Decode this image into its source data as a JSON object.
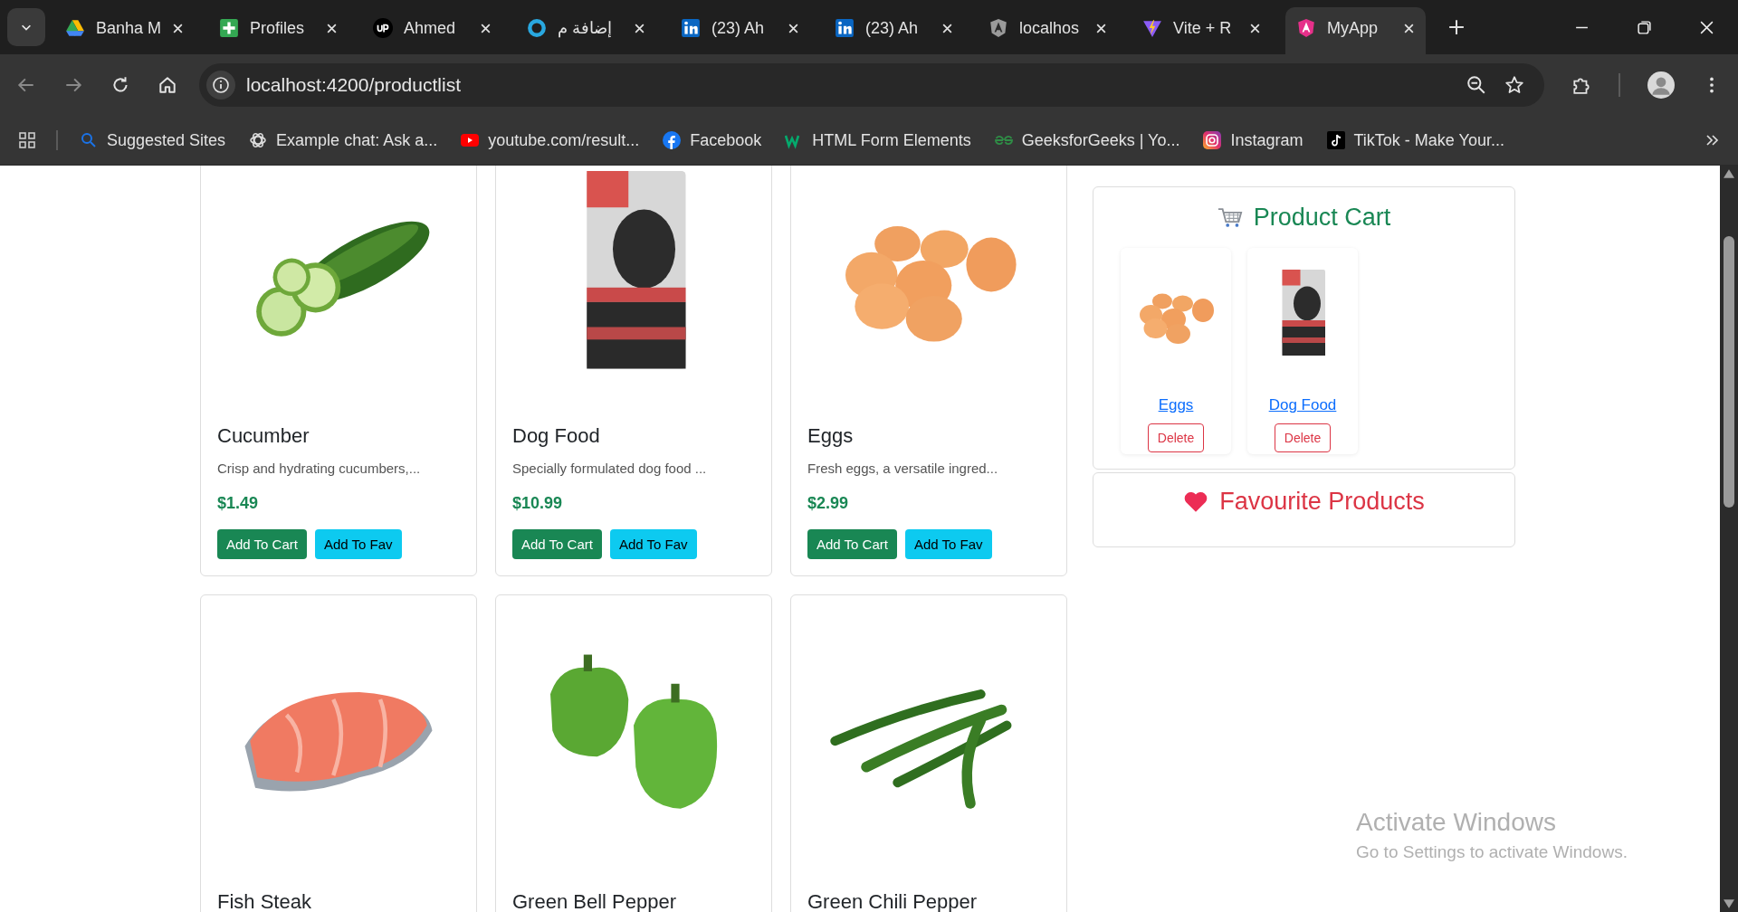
{
  "browser": {
    "tabs": [
      {
        "title": "Banha M",
        "selected": false
      },
      {
        "title": "Profiles",
        "selected": false
      },
      {
        "title": "Ahmed",
        "selected": false
      },
      {
        "title": "إضافة م",
        "selected": false
      },
      {
        "title": "(23) Ah",
        "selected": false
      },
      {
        "title": "(23) Ah",
        "selected": false
      },
      {
        "title": "localhos",
        "selected": false
      },
      {
        "title": "Vite + R",
        "selected": false
      },
      {
        "title": "MyApp",
        "selected": true
      }
    ],
    "address": "localhost:4200/productlist",
    "bookmarks": [
      {
        "label": "Suggested Sites"
      },
      {
        "label": "Example chat: Ask a..."
      },
      {
        "label": "youtube.com/result..."
      },
      {
        "label": "Facebook"
      },
      {
        "label": "HTML Form Elements"
      },
      {
        "label": "GeeksforGeeks | Yo..."
      },
      {
        "label": "Instagram"
      },
      {
        "label": "TikTok - Make Your..."
      }
    ]
  },
  "products": [
    {
      "kind": "cucumber",
      "name": "Cucumber",
      "description": "Crisp and hydrating cucumbers,...",
      "price": "$1.49",
      "cart_button": "Add To Cart",
      "fav_button": "Add To Fav"
    },
    {
      "kind": "dog-food",
      "name": "Dog Food",
      "description": "Specially formulated dog food ...",
      "price": "$10.99",
      "cart_button": "Add To Cart",
      "fav_button": "Add To Fav"
    },
    {
      "kind": "eggs",
      "name": "Eggs",
      "description": "Fresh eggs, a versatile ingred...",
      "price": "$2.99",
      "cart_button": "Add To Cart",
      "fav_button": "Add To Fav"
    },
    {
      "kind": "fish-steak",
      "name": "Fish Steak"
    },
    {
      "kind": "bell-pepper",
      "name": "Green Bell Pepper"
    },
    {
      "kind": "chili-pepper",
      "name": "Green Chili Pepper"
    }
  ],
  "cart": {
    "title": "Product Cart",
    "items": [
      {
        "kind": "eggs",
        "name": "Eggs",
        "button": "Delete"
      },
      {
        "kind": "dog-food",
        "name": "Dog Food",
        "button": "Delete"
      }
    ]
  },
  "favourites": {
    "title": "Favourite Products"
  },
  "activation_notice": {
    "title": "Activate Windows",
    "message": "Go to Settings to activate Windows."
  }
}
